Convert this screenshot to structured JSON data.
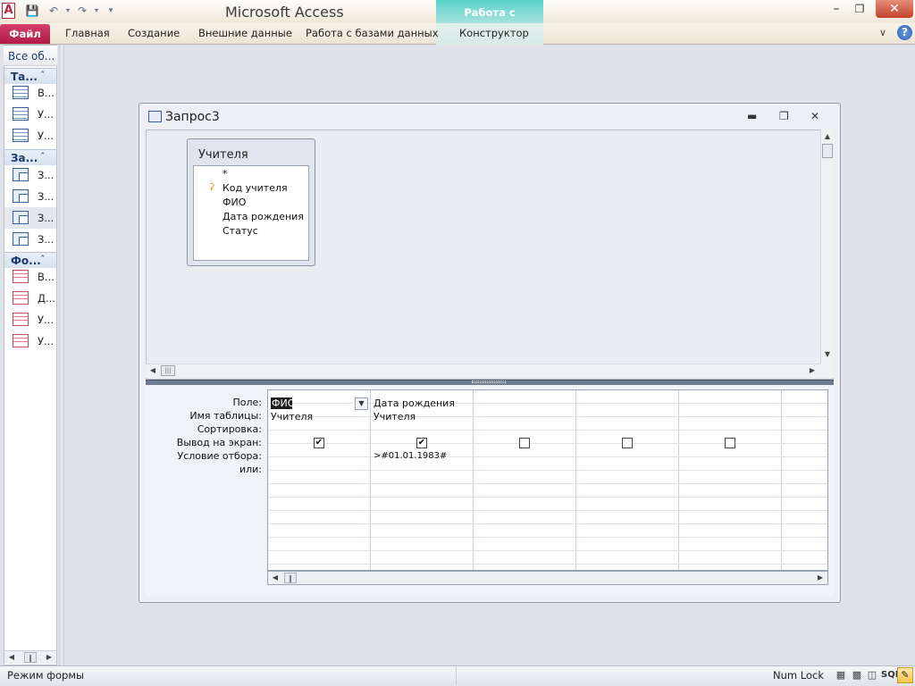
{
  "window": {
    "title": "Microsoft Access",
    "context_group": "Работа с запросами"
  },
  "icons": {
    "app": "A",
    "save": "save-icon",
    "undo": "undo-icon",
    "redo": "redo-icon",
    "qat_customize": "dropdown-icon"
  },
  "ribbon": {
    "file": "Файл",
    "tabs": [
      "Главная",
      "Создание",
      "Внешние данные",
      "Работа с базами данных",
      "Конструктор"
    ]
  },
  "nav": {
    "header": "Все об...",
    "groups": [
      {
        "label": "Та...",
        "items": [
          "В...",
          "У...",
          "У..."
        ]
      },
      {
        "label": "За...",
        "items": [
          "З...",
          "З...",
          "З...",
          "З..."
        ]
      },
      {
        "label": "Фо...",
        "items": [
          "В...",
          "Д...",
          "У...",
          "У..."
        ]
      }
    ]
  },
  "query": {
    "title": "Запрос3",
    "table": {
      "name": "Учителя",
      "fields": [
        "*",
        "Код учителя",
        "ФИО",
        "Дата рождения",
        "Статус"
      ]
    },
    "row_labels": [
      "Поле:",
      "Имя таблицы:",
      "Сортировка:",
      "Вывод на экран:",
      "Условие отбора:",
      "или:"
    ],
    "columns": [
      {
        "field": "ФИО",
        "table": "Учителя",
        "sort": "",
        "show": true,
        "criteria": ""
      },
      {
        "field": "Дата рождения",
        "table": "Учителя",
        "sort": "",
        "show": true,
        "criteria": ">#01.01.1983#"
      },
      {
        "field": "",
        "table": "",
        "sort": "",
        "show": false,
        "criteria": ""
      },
      {
        "field": "",
        "table": "",
        "sort": "",
        "show": false,
        "criteria": ""
      },
      {
        "field": "",
        "table": "",
        "sort": "",
        "show": false,
        "criteria": ""
      }
    ]
  },
  "status": {
    "mode": "Режим формы",
    "numlock": "Num Lock",
    "sql": "SQL"
  }
}
